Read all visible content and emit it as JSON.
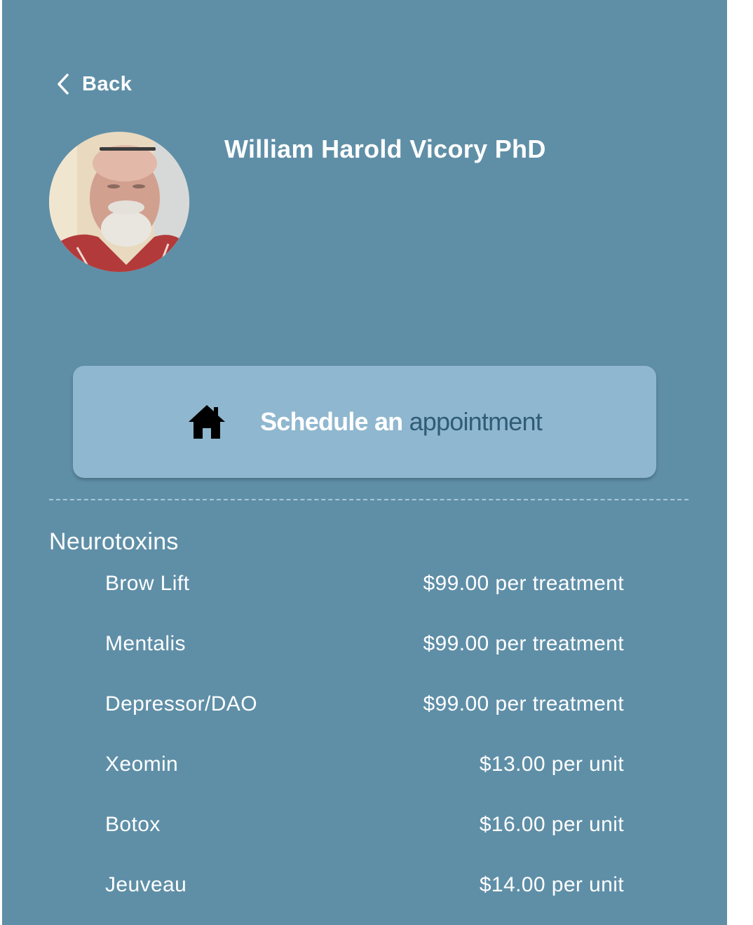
{
  "nav": {
    "back_label": "Back"
  },
  "provider": {
    "name": "William Harold Vicory PhD"
  },
  "schedule": {
    "label_part1": "Schedule an",
    "label_part2": "appointment",
    "icon": "home-icon"
  },
  "section": {
    "title": "Neurotoxins"
  },
  "services": [
    {
      "name": "Brow Lift",
      "price": "$99.00",
      "unit": "per treatment"
    },
    {
      "name": "Mentalis",
      "price": "$99.00",
      "unit": "per treatment"
    },
    {
      "name": "Depressor/DAO",
      "price": "$99.00",
      "unit": "per treatment"
    },
    {
      "name": "Xeomin",
      "price": "$13.00",
      "unit": "per unit"
    },
    {
      "name": "Botox",
      "price": "$16.00",
      "unit": "per unit"
    },
    {
      "name": "Jeuveau",
      "price": "$14.00",
      "unit": "per unit"
    }
  ],
  "colors": {
    "background": "#5f8fa7",
    "button": "#8fb7cf",
    "accent_text": "#2f5c78"
  }
}
